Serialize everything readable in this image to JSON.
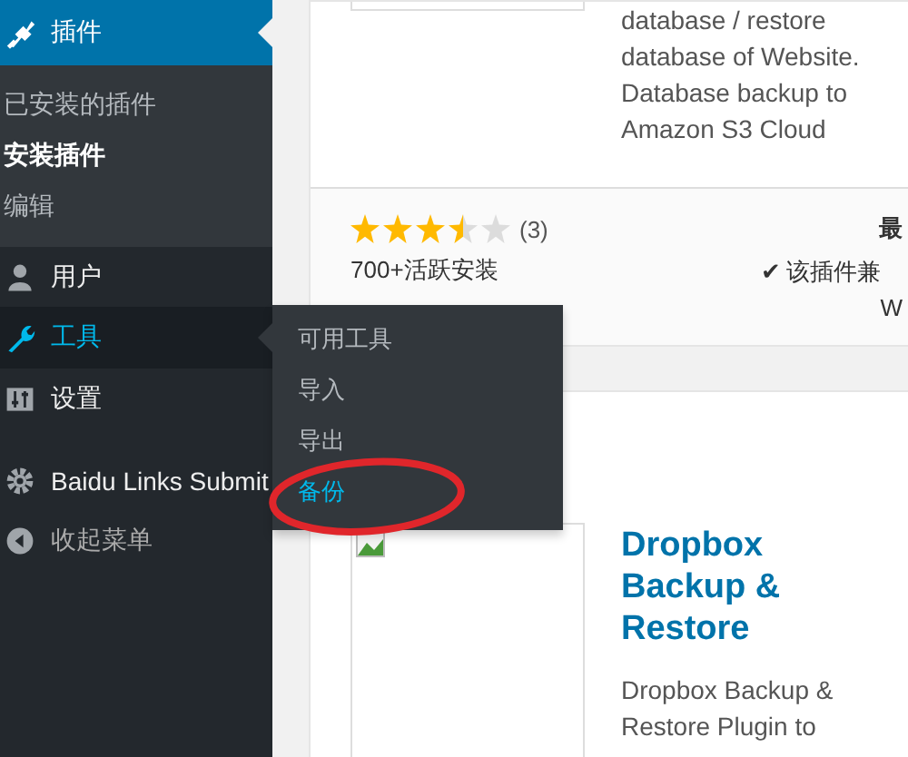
{
  "sidebar": {
    "current": {
      "label": "插件",
      "kind": "plugin",
      "submenu": [
        {
          "label": "已安装的插件",
          "selected": false
        },
        {
          "label": "安装插件",
          "selected": true
        },
        {
          "label": "编辑",
          "selected": false
        }
      ]
    },
    "items": [
      {
        "label": "用户",
        "kind": "user",
        "hover": false
      },
      {
        "label": "工具",
        "kind": "tools",
        "hover": true
      },
      {
        "label": "设置",
        "kind": "settings",
        "hover": false
      },
      {
        "label": "Baidu Links Submit",
        "kind": "gear",
        "hover": false
      }
    ],
    "collapse": "收起菜单"
  },
  "flyout": {
    "items": [
      {
        "label": "可用工具",
        "selected": false
      },
      {
        "label": "导入",
        "selected": false
      },
      {
        "label": "导出",
        "selected": false
      },
      {
        "label": "备份",
        "selected": true
      }
    ]
  },
  "cards": [
    {
      "description_lines": [
        "database / restore",
        "database of Website.",
        "Database backup to",
        "Amazon S3 Cloud"
      ],
      "stars": 3.5,
      "rating_count": "(3)",
      "installs": "700+活跃安装",
      "column_2": "最",
      "check": "✔",
      "compatibility": "该插件兼",
      "column_3": "W"
    },
    {
      "title_lines": [
        "Dropbox",
        "Backup &",
        "Restore"
      ],
      "description_lines": [
        "Dropbox Backup &",
        "Restore Plugin to"
      ]
    }
  ]
}
